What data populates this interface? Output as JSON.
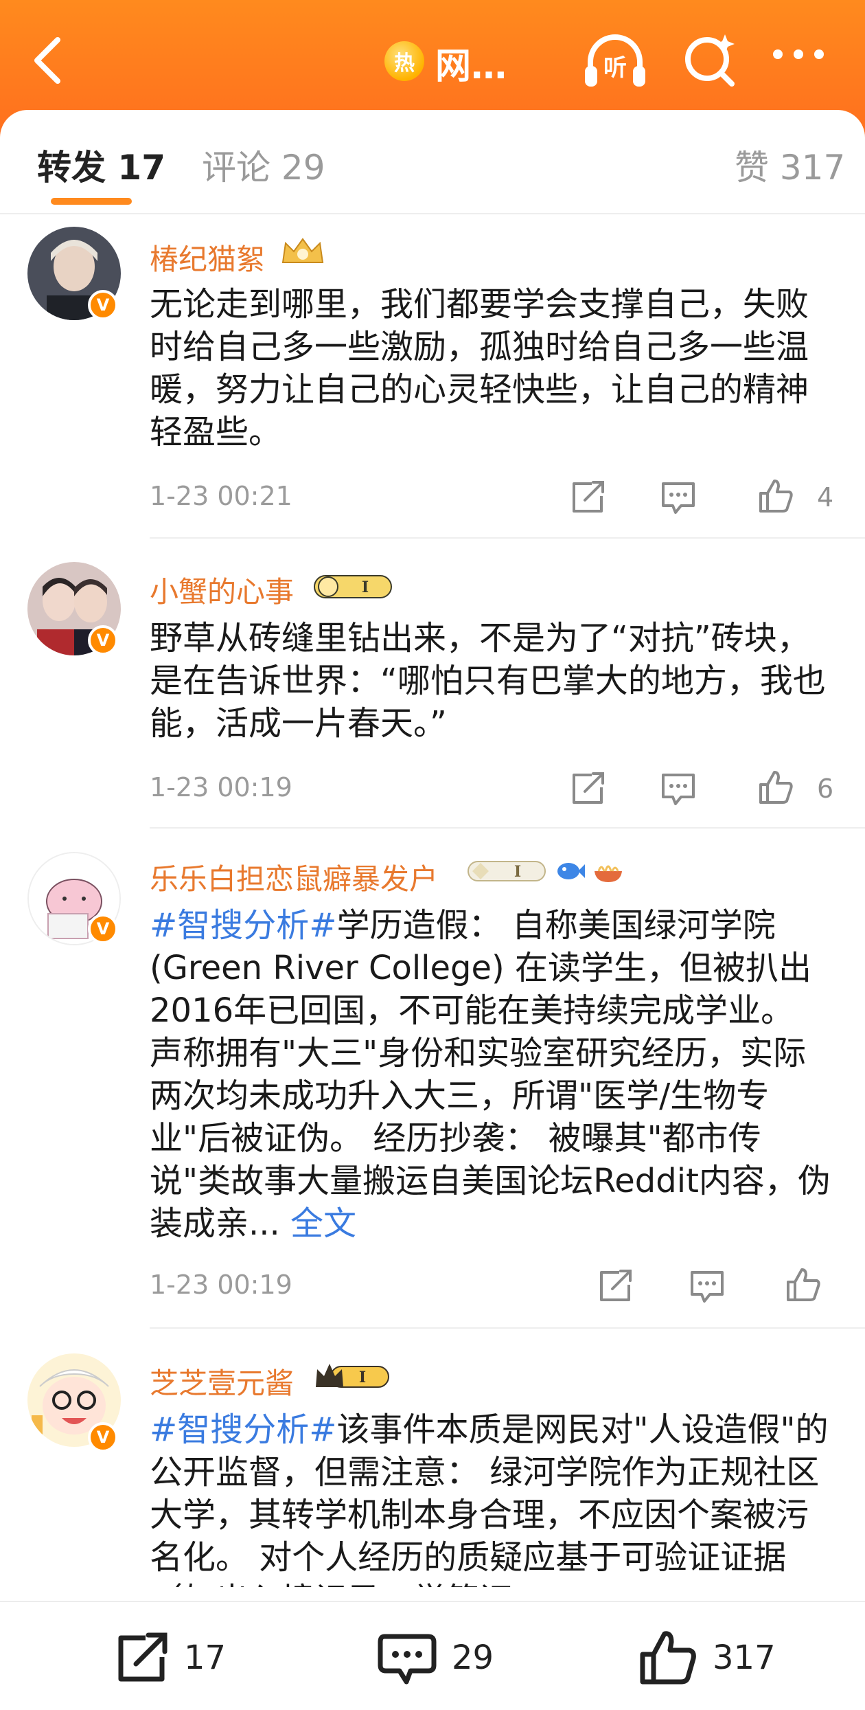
{
  "header": {
    "hot_badge": "热",
    "title": "网…",
    "listen_label": "听"
  },
  "tabs": [
    {
      "label": "转发 17"
    },
    {
      "label": "评论 29"
    },
    {
      "label": "赞 317"
    }
  ],
  "comments": [
    {
      "username": "椿纪猫絮",
      "text": "无论走到哪里，我们都要学会支撑自己，失败时给自己多一些激励，孤独时给自己多一些温暖，努力让自己的心灵轻快些，让自己的精神轻盈些。",
      "time": "1-23 00:21",
      "likes": "4"
    },
    {
      "username": "小蟹的心事",
      "text": "野草从砖缝里钻出来，不是为了“对抗”砖块，是在告诉世界：“哪怕只有巴掌大的地方，我也能，活成一片春天。”",
      "time": "1-23 00:19",
      "likes": "6"
    },
    {
      "username": "乐乐白担恋鼠癖暴发户",
      "tag": "#智搜分析#",
      "text": "学历造假： 自称美国绿河学院(Green River College) 在读学生，但被扒出2016年已回国，不可能在美持续完成学业。 声称拥有\"大三\"身份和实验室研究经历，实际两次均未成功升入大三，所谓\"医学/生物专业\"后被证伪。 经历抄袭： 被曝其\"都市传说\"类故事大量搬运自美国论坛Reddit内容，伪装成亲...",
      "more": "全文",
      "time": "1-23 00:19",
      "likes": ""
    },
    {
      "username": "芝芝壹元酱",
      "tag": "#智搜分析#",
      "text": "该事件本质是网民对\"人设造假\"的公开监督，但需注意： 绿河学院作为正规社区大学，其转学机制本身合理，不应因个案被污名化。 对个人经历的质疑应基于可验证证据（如出入境记录、学籍证"
    }
  ],
  "bottom_bar": {
    "repost_count": "17",
    "comment_count": "29",
    "like_count": "317"
  }
}
